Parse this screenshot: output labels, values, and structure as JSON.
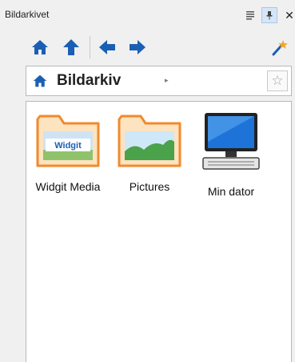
{
  "window": {
    "title": "Bildarkivet",
    "close_glyph": "✕"
  },
  "toolbar": {
    "icons": [
      "home-icon",
      "up-arrow-icon",
      "back-arrow-icon",
      "forward-arrow-icon",
      "magic-wand-icon"
    ]
  },
  "breadcrumb": {
    "label": "Bildarkiv",
    "arrow": "▸",
    "star": "☆"
  },
  "items": [
    {
      "label": "Widgit Media",
      "icon": "folder-widgit-icon",
      "badge": "Widgit"
    },
    {
      "label": "Pictures",
      "icon": "folder-pictures-icon"
    },
    {
      "label": "Min dator",
      "icon": "computer-icon"
    }
  ],
  "colors": {
    "accent_blue": "#1a5fb4",
    "folder_orange": "#f08a2e",
    "folder_fill": "#fde3bf"
  }
}
